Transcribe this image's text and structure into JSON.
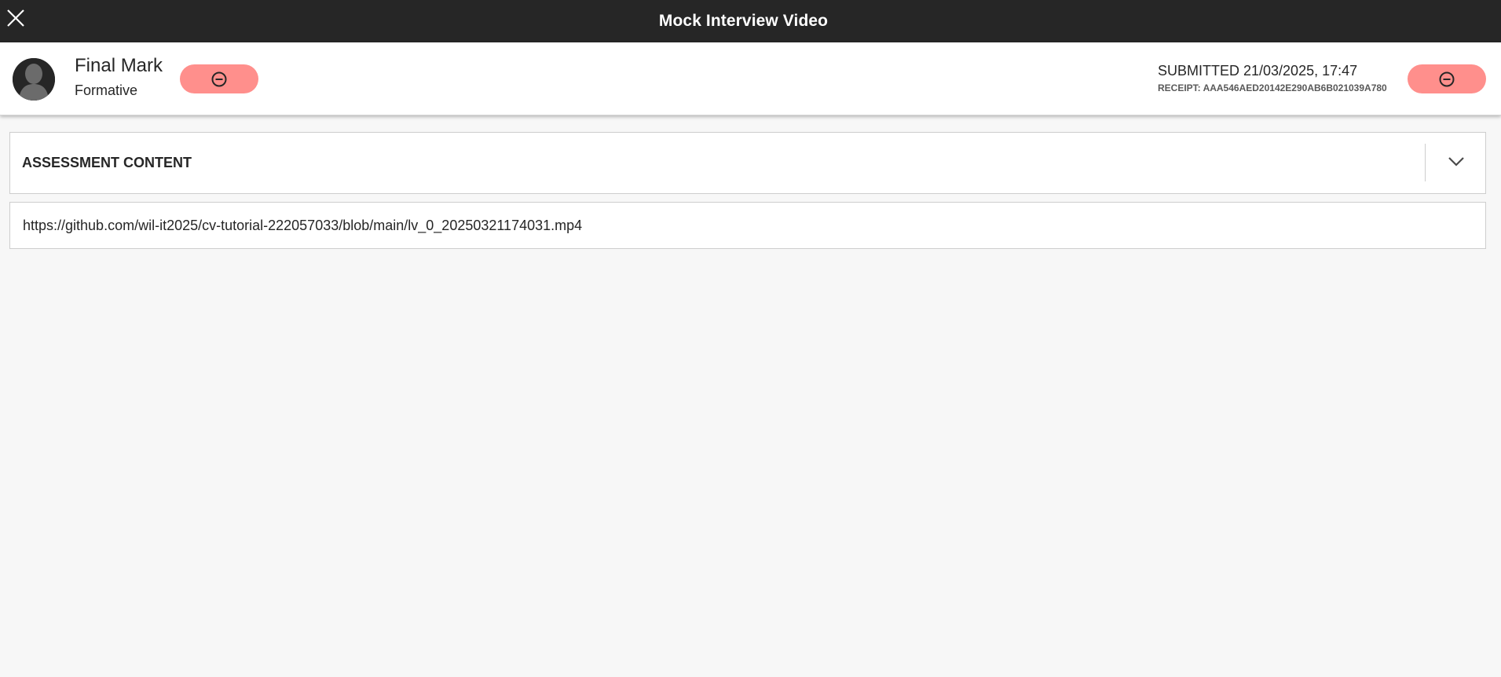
{
  "topbar": {
    "title": "Mock Interview Video",
    "close_icon": "close-icon"
  },
  "header": {
    "avatar_icon": "user-avatar-icon",
    "title": "Final Mark",
    "subtitle": "Formative",
    "left_action_icon": "minus-circle-icon",
    "submitted": "SUBMITTED 21/03/2025, 17:47",
    "receipt": "RECEIPT: AAA546AED20142E290AB6B021039A780",
    "right_action_icon": "minus-circle-icon",
    "accent_color": "#ff8f8c"
  },
  "accordion": {
    "title": "ASSESSMENT CONTENT",
    "toggle_icon": "chevron-down-icon",
    "expanded": false
  },
  "content": {
    "link_text": "https://github.com/wil-it2025/cv-tutorial-222057033/blob/main/lv_0_20250321174031.mp4"
  },
  "colors": {
    "topbar_bg": "#262626",
    "page_bg": "#f7f7f7",
    "pill_bg": "#ff8f8c"
  }
}
